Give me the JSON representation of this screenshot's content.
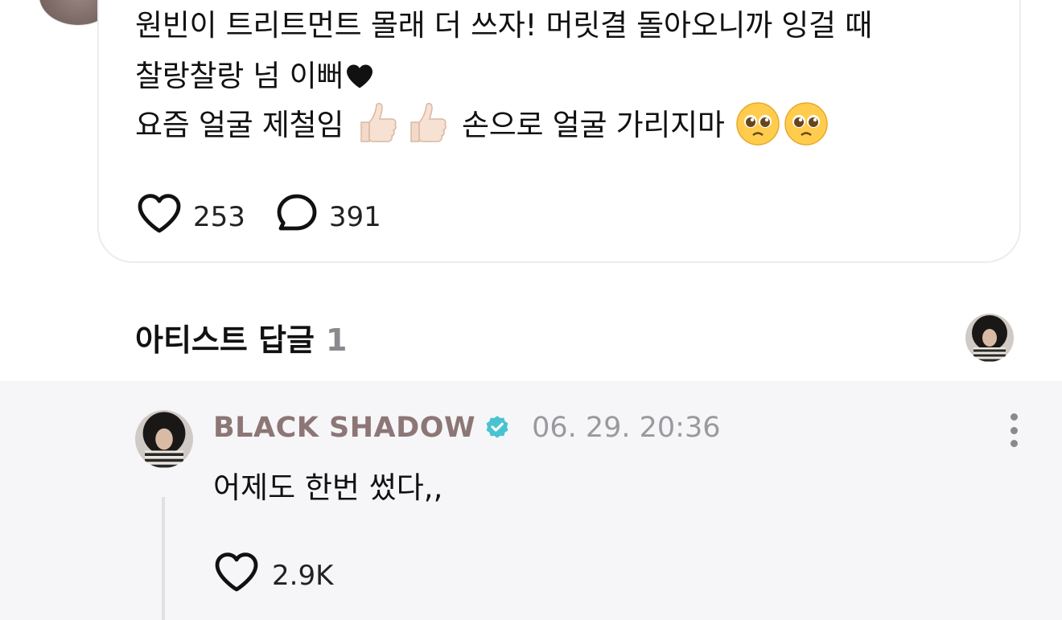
{
  "post": {
    "line1": "원빈이 트리트먼트 몰래 더 쓰자! 머릿결 돌아오니까 잉걸 때",
    "line2": "찰랑찰랑 넘 이뻐",
    "line3_a": "요즘 얼굴 제철임",
    "line3_b": "손으로 얼굴 가리지마",
    "likes": "253",
    "comments": "391"
  },
  "artist_reply_section": {
    "title": "아티스트 답글",
    "count": "1"
  },
  "reply": {
    "author": "BLACK SHADOW",
    "timestamp": "06. 29. 20:36",
    "text": "어제도 한번 썼다,,",
    "likes": "2.9K"
  },
  "icons": {
    "post_like": "heart-outline-icon",
    "post_comment": "comment-bubble-icon",
    "verified": "verified-badge-icon",
    "more": "more-vertical-icon",
    "reply_like": "heart-outline-icon"
  },
  "colors": {
    "author": "#8d7676",
    "verified": "#49c3cf",
    "timestamp": "#9a9a9e",
    "panel_bg": "#f6f6f8",
    "card_border": "#ececef"
  }
}
